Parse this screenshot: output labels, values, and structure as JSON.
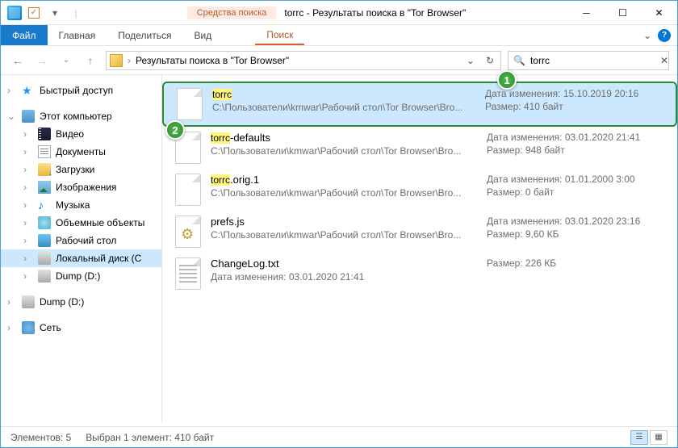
{
  "window": {
    "title": "torrc - Результаты поиска в \"Tor Browser\"",
    "search_tools_label": "Средства поиска"
  },
  "ribbon": {
    "file": "Файл",
    "home": "Главная",
    "share": "Поделиться",
    "view": "Вид",
    "search": "Поиск"
  },
  "nav": {
    "breadcrumb": "Результаты поиска в \"Tor Browser\"",
    "search_value": "torrc"
  },
  "sidebar": {
    "quick_access": "Быстрый доступ",
    "this_pc": "Этот компьютер",
    "videos": "Видео",
    "documents": "Документы",
    "downloads": "Загрузки",
    "pictures": "Изображения",
    "music": "Музыка",
    "objects3d": "Объемные объекты",
    "desktop": "Рабочий стол",
    "local_disk": "Локальный диск (С",
    "dump_d": "Dump (D:)",
    "dump_d2": "Dump (D:)",
    "network": "Сеть"
  },
  "results": [
    {
      "name_hl": "torrc",
      "name_rest": "",
      "path": "С:\\Пользователи\\kmwar\\Рабочий стол\\Tor Browser\\Bro...",
      "date_label": "Дата изменения:",
      "date": "15.10.2019 20:16",
      "size_label": "Размер:",
      "size": "410 байт",
      "icon": "plain",
      "selected": true
    },
    {
      "name_hl": "torrc",
      "name_rest": "-defaults",
      "path": "С:\\Пользователи\\kmwar\\Рабочий стол\\Tor Browser\\Bro...",
      "date_label": "Дата изменения:",
      "date": "03.01.2020 21:41",
      "size_label": "Размер:",
      "size": "948 байт",
      "icon": "plain",
      "selected": false
    },
    {
      "name_hl": "torrc",
      "name_rest": ".orig.1",
      "path": "С:\\Пользователи\\kmwar\\Рабочий стол\\Tor Browser\\Bro...",
      "date_label": "Дата изменения:",
      "date": "01.01.2000 3:00",
      "size_label": "Размер:",
      "size": "0 байт",
      "icon": "plain",
      "selected": false
    },
    {
      "name_hl": "",
      "name_rest": "prefs.js",
      "path": "С:\\Пользователи\\kmwar\\Рабочий стол\\Tor Browser\\Bro...",
      "date_label": "Дата изменения:",
      "date": "03.01.2020 23:16",
      "size_label": "Размер:",
      "size": "9,60 КБ",
      "icon": "js",
      "selected": false
    },
    {
      "name_hl": "",
      "name_rest": "ChangeLog.txt",
      "path_label": "Дата изменения:",
      "path": "03.01.2020 21:41",
      "date_label": "",
      "date": "",
      "size_label": "Размер:",
      "size": "226 КБ",
      "icon": "lines",
      "selected": false
    }
  ],
  "status": {
    "count": "Элементов: 5",
    "selection": "Выбран 1 элемент: 410 байт"
  },
  "badges": {
    "b1": "1",
    "b2": "2"
  }
}
